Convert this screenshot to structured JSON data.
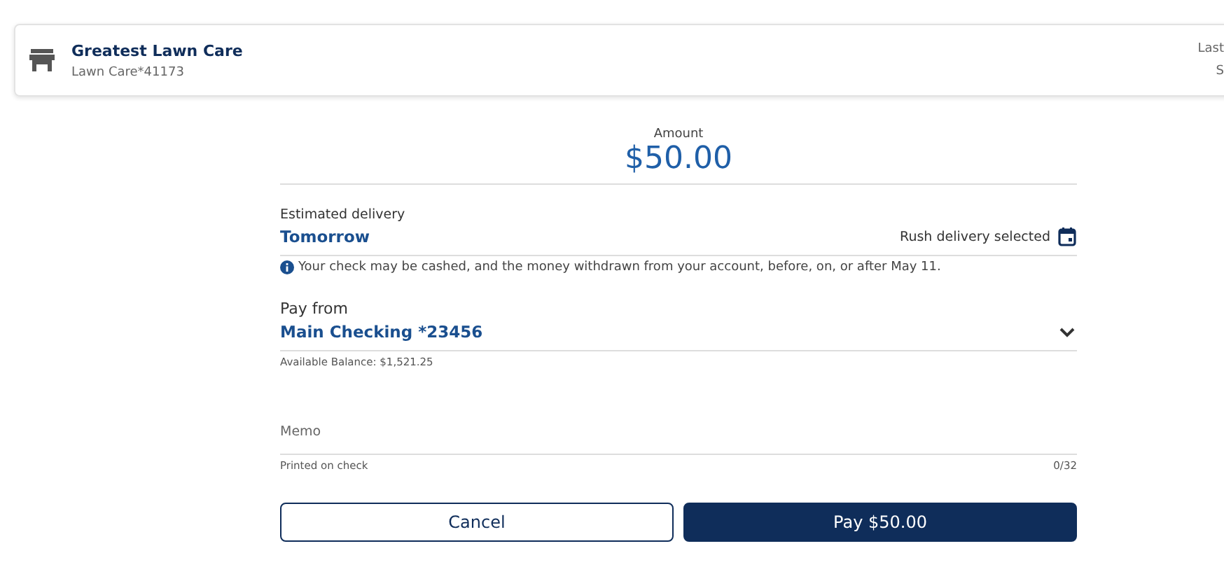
{
  "payee": {
    "name": "Greatest Lawn Care",
    "account": "Lawn Care*41173",
    "right_line_1": "Last",
    "right_line_2": "S"
  },
  "amount": {
    "label": "Amount",
    "value": "$50.00"
  },
  "delivery": {
    "label": "Estimated delivery",
    "value": "Tomorrow",
    "option": "Rush delivery selected",
    "note": "Your check may be cashed, and the money withdrawn from your account, before, on, or after May 11."
  },
  "pay_from": {
    "label": "Pay from",
    "value": "Main Checking *23456",
    "helper": "Available Balance: $1,521.25"
  },
  "memo": {
    "placeholder": "Memo",
    "helper": "Printed on check",
    "counter": "0/32"
  },
  "buttons": [
    {
      "label": "Cancel",
      "kind": "secondary"
    },
    {
      "label": "Pay $50.00",
      "kind": "primary"
    }
  ]
}
